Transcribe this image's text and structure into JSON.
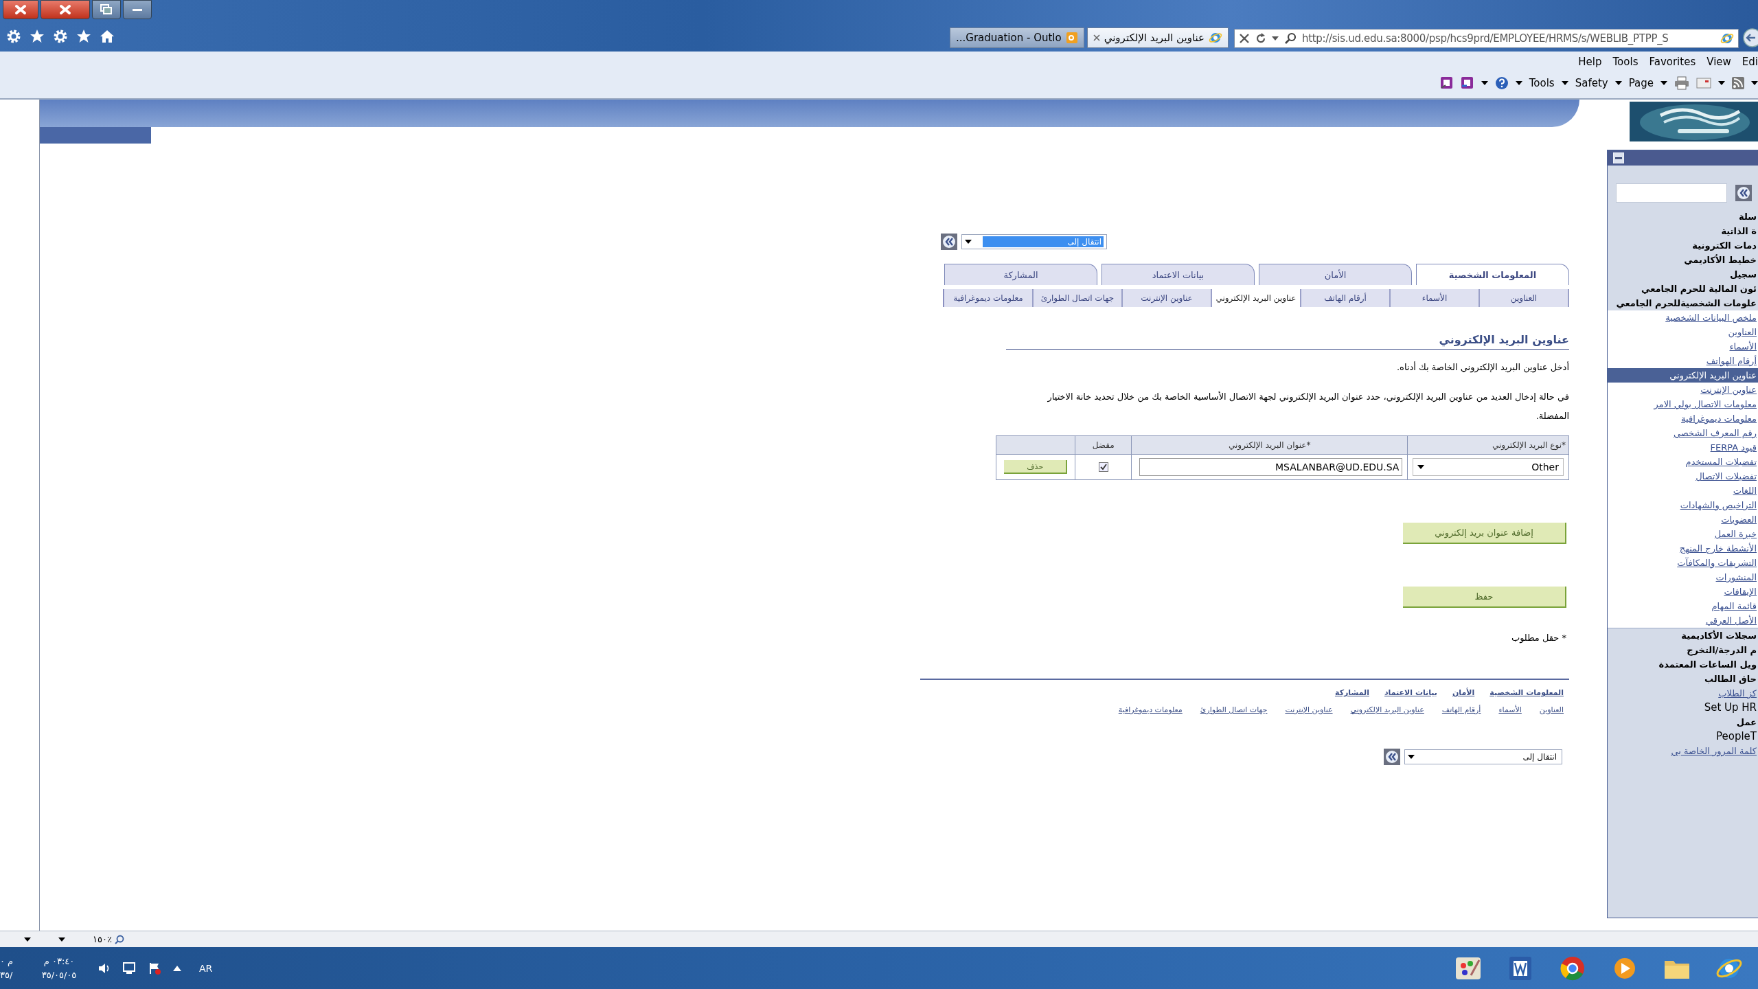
{
  "browser": {
    "tabs": [
      {
        "label": "عناوين البريد الإلكتروني",
        "selected": true
      },
      {
        "label": "...Graduation - Outlo",
        "selected": false
      }
    ],
    "address": "http://sis.ud.edu.sa:8000/psp/hcs9prd/EMPLOYEE/HRMS/s/WEBLIB_PTPP_S",
    "menu": [
      "Edi",
      "View",
      "Favorites",
      "Tools",
      "Help"
    ],
    "command_bar": [
      "Page",
      "Safety",
      "Tools"
    ]
  },
  "page": {
    "jump_top": {
      "value": "انتقال إلى",
      "highlighted": true
    },
    "tabs": [
      {
        "label": "المعلومات الشخصية",
        "selected": true
      },
      {
        "label": "الأمان",
        "selected": false
      },
      {
        "label": "بيانات الاعتماد",
        "selected": false
      },
      {
        "label": "المشاركة",
        "selected": false
      }
    ],
    "subtabs": [
      {
        "label": "العناوين",
        "selected": false
      },
      {
        "label": "الأسماء",
        "selected": false
      },
      {
        "label": "أرقام الهاتف",
        "selected": false
      },
      {
        "label": "عناوين البريد الإلكتروني",
        "selected": true
      },
      {
        "label": "عناوين الإنترنت",
        "selected": false
      },
      {
        "label": "جهات اتصال الطوارئ",
        "selected": false
      },
      {
        "label": "معلومات ديموغرافية",
        "selected": false
      }
    ],
    "title": "عناوين البريد الإلكتروني",
    "instructions": [
      "أدخل عناوين البريد الإلكتروني الخاصة بك أدناه.",
      "في حالة إدخال العديد من عناوين البريد الإلكتروني، حدد عنوان البريد الإلكتروني لجهة الاتصال الأساسية الخاصة بك من خلال تحديد خانة الاختيار المفضلة."
    ],
    "table": {
      "columns": [
        "*نوع البريد الإلكتروني",
        "*عنوان البريد الإلكتروني",
        "مفضل"
      ],
      "rows": [
        {
          "type": "Other",
          "address": "MSALANBAR@UD.EDU.SA",
          "preferred": true,
          "action": "حذف"
        }
      ]
    },
    "add_button": "إضافة عنوان بريد إلكتروني",
    "save_button": "حفظ",
    "required_note": "* حقل مطلوب",
    "footer_tabs": [
      "المعلومات الشخصية",
      "الأمان",
      "بيانات الاعتماد",
      "المشاركة"
    ],
    "footer_subtabs": [
      "العناوين",
      "الأسماء",
      "أرقام الهاتف",
      "عناوين البريد الإلكتروني",
      "عناوين الإنترنت",
      "جهات اتصال الطوارئ",
      "معلومات ديموغرافية"
    ],
    "jump_bottom": {
      "value": "انتقال إلى",
      "highlighted": false
    }
  },
  "sidebar": {
    "items": [
      {
        "kind": "folder",
        "label": "سلة"
      },
      {
        "kind": "folder",
        "label": "ة الذاتية"
      },
      {
        "kind": "folder",
        "label": "دمات الكترونية"
      },
      {
        "kind": "folder",
        "label": "خطيط الأكاديمي"
      },
      {
        "kind": "folder",
        "label": "سجيل"
      },
      {
        "kind": "folder",
        "label": "ئون المالية للحرم الجامعي"
      },
      {
        "kind": "folder",
        "label": "علومات الشخصيةللحرم الجامعي",
        "children": [
          {
            "label": "ملخص البيانات الشخصية",
            "selected": false
          },
          {
            "label": "العناوين",
            "selected": false
          },
          {
            "label": "الأسماء",
            "selected": false
          },
          {
            "label": "أرقام الهواتف",
            "selected": false
          },
          {
            "label": "عناوين البريد الإلكتروني",
            "selected": true
          },
          {
            "label": "عناوين الإنترنت",
            "selected": false
          },
          {
            "label": "معلومات الاتصال بولي الامر",
            "selected": false
          },
          {
            "label": "معلومات ديموغرافية",
            "selected": false
          },
          {
            "label": "رقم المعرف الشخصي",
            "selected": false
          },
          {
            "label": "قيود FERPA",
            "selected": false
          },
          {
            "label": "تفضيلات المستخدم",
            "selected": false
          },
          {
            "label": "تفضيلات الاتصال",
            "selected": false
          },
          {
            "label": "اللغات",
            "selected": false
          },
          {
            "label": "التراخيص والشهادات",
            "selected": false
          },
          {
            "label": "العضويات",
            "selected": false
          },
          {
            "label": "خبرة العمل",
            "selected": false
          },
          {
            "label": "الأنشطة خارج المنهج",
            "selected": false
          },
          {
            "label": "التشريفات والمكافآت",
            "selected": false
          },
          {
            "label": "المنشورات",
            "selected": false
          },
          {
            "label": "الإيقافات",
            "selected": false
          },
          {
            "label": "قائمة المهام",
            "selected": false
          },
          {
            "label": "الأصل العرقي",
            "selected": false
          }
        ]
      },
      {
        "kind": "folder",
        "label": "سجلات الأكاديمية"
      },
      {
        "kind": "folder",
        "label": "م الدرجة/التخرج"
      },
      {
        "kind": "folder",
        "label": "ويل الساعات المعتمدة"
      },
      {
        "kind": "folder",
        "label": "حاق الطالب"
      },
      {
        "kind": "link",
        "label": "كز الطلاب"
      },
      {
        "kind": "latin",
        "label": "Set Up HR"
      },
      {
        "kind": "folder",
        "label": "عمل"
      },
      {
        "kind": "latin",
        "label": "PeopleT"
      },
      {
        "kind": "link",
        "label": "كلمة المرور الخاصة بي"
      }
    ]
  },
  "status_bar": {
    "zoom": "١٥٠٪"
  },
  "taskbar": {
    "clocks": [
      {
        "time": "٠٣:٤٠ م",
        "date": "٣٥/٠٥/٠٥"
      },
      {
        "time": "م ٠",
        "date": "٣٥/"
      }
    ],
    "language": "AR"
  }
}
